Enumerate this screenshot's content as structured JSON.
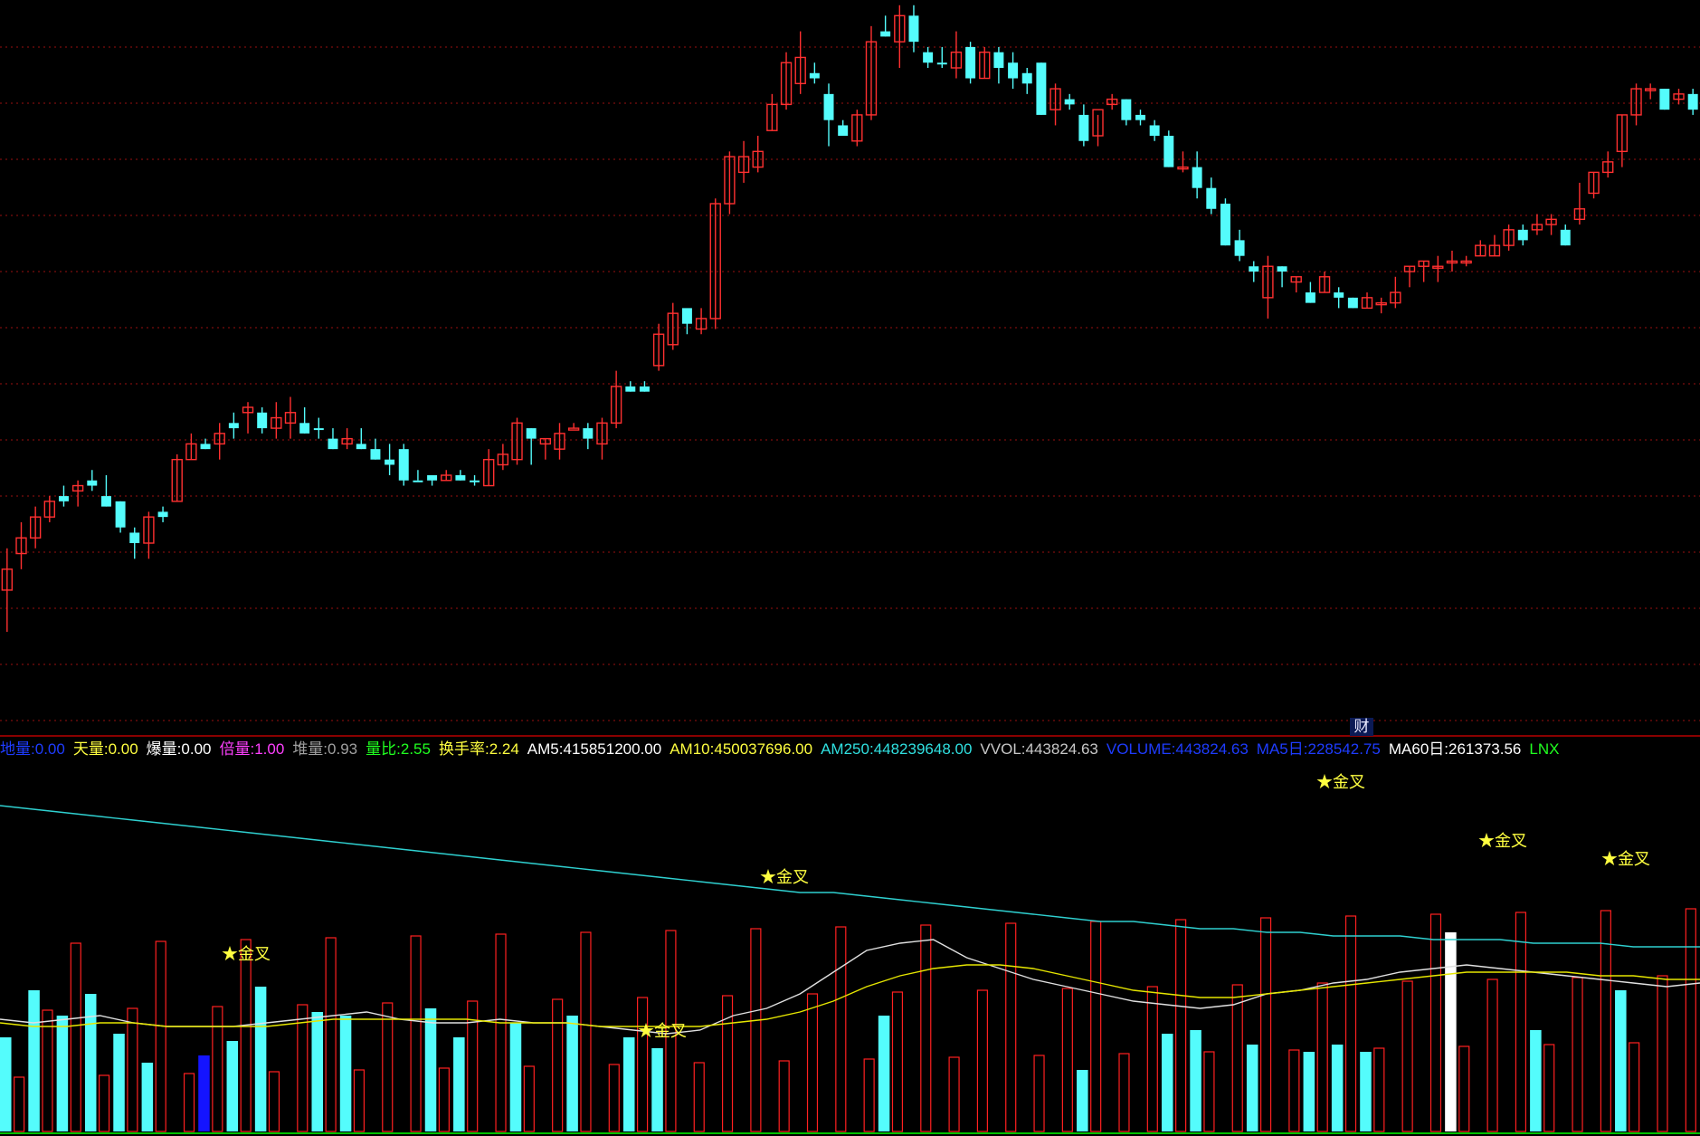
{
  "colors": {
    "up": "#ff3030",
    "down": "#54fcfc",
    "grid": "#9a1010",
    "vol_fill_up": "#54fcfc",
    "vol_outline": "#ff2020",
    "vol_magenta": "#ff20ff",
    "vol_blue": "#1414ff",
    "vol_white": "#ffffff",
    "ma5_line": "#e0e0e0",
    "ma10_line": "#e6e600",
    "ma250_line": "#2fd0d0",
    "label_gold": "#ffff40"
  },
  "fin_badge": "财",
  "indicator_bar": [
    {
      "label": "地量:",
      "value": "0.00",
      "color": "#1e3cff"
    },
    {
      "label": "天量:",
      "value": "0.00",
      "color": "#ffff40"
    },
    {
      "label": "爆量:",
      "value": "0.00",
      "color": "#ffffff"
    },
    {
      "label": "倍量:",
      "value": "1.00",
      "color": "#ff40ff"
    },
    {
      "label": "堆量:",
      "value": "0.93",
      "color": "#a0a0a0"
    },
    {
      "label": "量比:",
      "value": "2.55",
      "color": "#20ff20"
    },
    {
      "label": "换手率:",
      "value": "2.24",
      "color": "#ffff40"
    },
    {
      "label": "AM5:",
      "value": "415851200.00",
      "color": "#ffffff"
    },
    {
      "label": "AM10:",
      "value": "450037696.00",
      "color": "#ffff40"
    },
    {
      "label": "AM250:",
      "value": "448239648.00",
      "color": "#30e0e0"
    },
    {
      "label": "VVOL:",
      "value": "443824.63",
      "color": "#c8c8c8"
    },
    {
      "label": "VOLUME:",
      "value": "443824.63",
      "color": "#1e3cff"
    },
    {
      "label": "MA5日:",
      "value": "228542.75",
      "color": "#1e3cff"
    },
    {
      "label": "MA60日:",
      "value": "261373.56",
      "color": "#ffffff"
    },
    {
      "label": "LNX",
      "value": "",
      "color": "#20ff20"
    }
  ],
  "chart_data": [
    {
      "type": "candlestick",
      "price_range": [
        0,
        100
      ],
      "grid": true,
      "candles": [
        [
          17,
          21,
          9,
          25,
          1
        ],
        [
          24,
          27,
          21,
          30,
          1
        ],
        [
          27,
          31,
          25,
          33,
          1
        ],
        [
          31,
          34,
          30,
          35,
          1
        ],
        [
          34,
          35,
          33,
          37,
          0
        ],
        [
          36,
          37,
          33,
          38,
          1
        ],
        [
          37,
          38,
          36,
          40,
          0
        ],
        [
          35,
          33,
          33,
          39,
          0
        ],
        [
          34,
          29,
          28,
          34,
          0
        ],
        [
          28,
          26,
          23,
          29,
          0
        ],
        [
          26,
          31,
          23,
          32,
          1
        ],
        [
          31,
          32,
          30,
          33,
          0
        ],
        [
          34,
          42,
          34,
          43,
          1
        ],
        [
          42,
          45,
          42,
          47,
          1
        ],
        [
          44,
          45,
          44,
          46,
          0
        ],
        [
          45,
          47,
          42,
          49,
          1
        ],
        [
          48,
          49,
          46,
          51,
          0
        ],
        [
          52,
          51,
          47,
          53,
          1
        ],
        [
          51,
          48,
          47,
          52,
          0
        ],
        [
          48,
          50,
          46,
          53,
          1
        ],
        [
          51,
          49,
          46,
          54,
          1
        ],
        [
          49,
          47,
          47,
          52,
          0
        ],
        [
          48,
          48,
          46,
          50,
          0
        ],
        [
          46,
          44,
          44,
          48,
          0
        ],
        [
          45,
          46,
          44,
          48,
          1
        ],
        [
          45,
          44,
          44,
          48,
          0
        ],
        [
          44,
          42,
          42,
          46,
          0
        ],
        [
          42,
          41,
          39,
          45,
          0
        ],
        [
          44,
          38,
          37,
          45,
          0
        ],
        [
          38,
          38,
          38,
          40,
          0
        ],
        [
          39,
          38,
          37,
          39,
          0
        ],
        [
          38,
          39,
          38,
          40,
          1
        ],
        [
          39,
          38,
          38,
          40,
          0
        ],
        [
          38,
          38,
          37,
          39,
          0
        ],
        [
          37,
          42,
          37,
          44,
          1
        ],
        [
          41,
          43,
          40,
          45,
          1
        ],
        [
          42,
          49,
          41,
          50,
          1
        ],
        [
          48,
          46,
          41,
          48,
          0
        ],
        [
          45,
          46,
          42,
          46,
          1
        ],
        [
          44,
          47,
          42,
          49,
          1
        ],
        [
          48,
          48,
          48,
          49,
          1
        ],
        [
          48,
          46,
          44,
          49,
          0
        ],
        [
          45,
          49,
          42,
          50,
          1
        ],
        [
          49,
          56,
          48,
          59,
          1
        ],
        [
          55,
          56,
          55,
          57,
          0
        ],
        [
          56,
          55,
          55,
          57,
          0
        ],
        [
          60,
          66,
          59,
          68,
          1
        ],
        [
          64,
          70,
          63,
          72,
          1
        ],
        [
          71,
          68,
          66,
          70,
          0
        ],
        [
          67,
          69,
          66,
          71,
          1
        ],
        [
          69,
          91,
          67,
          92,
          1
        ],
        [
          91,
          100,
          89,
          101,
          1
        ],
        [
          100,
          97,
          95,
          103,
          1
        ],
        [
          98,
          101,
          97,
          104,
          1
        ],
        [
          105,
          110,
          105,
          112,
          1
        ],
        [
          110,
          118,
          109,
          120,
          1
        ],
        [
          119,
          114,
          112,
          124,
          1
        ],
        [
          116,
          115,
          114,
          118,
          0
        ],
        [
          112,
          107,
          102,
          114,
          0
        ],
        [
          106,
          104,
          104,
          107,
          0
        ],
        [
          103,
          108,
          102,
          109,
          1
        ],
        [
          108,
          122,
          107,
          125,
          1
        ],
        [
          124,
          123,
          123,
          127,
          0
        ],
        [
          122,
          127,
          117,
          129,
          1
        ],
        [
          127,
          122,
          120,
          129,
          0
        ],
        [
          120,
          118,
          117,
          121,
          0
        ],
        [
          118,
          118,
          117,
          121,
          0
        ],
        [
          117,
          120,
          115,
          124,
          1
        ],
        [
          121,
          115,
          114,
          122,
          0
        ],
        [
          120,
          115,
          115,
          121,
          1
        ],
        [
          120,
          117,
          114,
          121,
          0
        ],
        [
          118,
          115,
          113,
          120,
          0
        ],
        [
          116,
          114,
          112,
          117,
          0
        ],
        [
          118,
          108,
          108,
          118,
          0
        ],
        [
          109,
          113,
          106,
          114,
          1
        ],
        [
          111,
          110,
          109,
          112,
          0
        ],
        [
          108,
          103,
          102,
          110,
          0
        ],
        [
          104,
          109,
          102,
          108,
          1
        ],
        [
          111,
          110,
          109,
          112,
          1
        ],
        [
          111,
          107,
          106,
          111,
          0
        ],
        [
          108,
          107,
          106,
          109,
          0
        ],
        [
          106,
          104,
          103,
          107,
          0
        ],
        [
          104,
          98,
          98,
          105,
          0
        ],
        [
          98,
          98,
          97,
          101,
          1
        ],
        [
          98,
          94,
          92,
          101,
          0
        ],
        [
          94,
          90,
          89,
          96,
          0
        ],
        [
          91,
          83,
          83,
          92,
          0
        ],
        [
          84,
          81,
          80,
          86,
          0
        ],
        [
          79,
          78,
          76,
          80,
          0
        ],
        [
          79,
          73,
          69,
          81,
          1
        ],
        [
          79,
          78,
          75,
          79,
          0
        ],
        [
          76,
          77,
          74,
          77,
          1
        ],
        [
          74,
          72,
          72,
          76,
          0
        ],
        [
          77,
          74,
          74,
          78,
          1
        ],
        [
          74,
          73,
          71,
          75,
          0
        ],
        [
          73,
          71,
          71,
          73,
          0
        ],
        [
          73,
          71,
          71,
          74,
          1
        ],
        [
          72,
          72,
          70,
          73,
          1
        ],
        [
          72,
          74,
          71,
          77,
          1
        ],
        [
          78,
          79,
          75,
          79,
          1
        ],
        [
          79,
          80,
          76,
          80,
          1
        ],
        [
          79,
          79,
          76,
          81,
          1
        ],
        [
          80,
          80,
          78,
          82,
          1
        ],
        [
          80,
          80,
          79,
          81,
          1
        ],
        [
          81,
          83,
          81,
          84,
          1
        ],
        [
          81,
          83,
          81,
          85,
          1
        ],
        [
          83,
          86,
          82,
          87,
          1
        ],
        [
          86,
          84,
          83,
          87,
          0
        ],
        [
          86,
          87,
          85,
          89,
          1
        ],
        [
          87,
          88,
          85,
          89,
          1
        ],
        [
          86,
          83,
          83,
          87,
          0
        ],
        [
          88,
          90,
          87,
          95,
          1
        ],
        [
          93,
          97,
          92,
          97,
          1
        ],
        [
          97,
          99,
          96,
          101,
          1
        ],
        [
          101,
          108,
          98,
          108,
          1
        ],
        [
          108,
          113,
          106,
          114,
          1
        ],
        [
          113,
          113,
          111,
          114,
          1
        ],
        [
          113,
          109,
          109,
          113,
          0
        ],
        [
          111,
          112,
          110,
          113,
          1
        ],
        [
          112,
          109,
          108,
          113,
          0
        ]
      ]
    },
    {
      "type": "bar",
      "series": [
        {
          "name": "VOLUME",
          "values": [
            26,
            0,
            39,
            0,
            32,
            0,
            38,
            0,
            27,
            0,
            19,
            0,
            0,
            0,
            21,
            0,
            25,
            0,
            40,
            0,
            0,
            0,
            33,
            0,
            32,
            0,
            0,
            0,
            0,
            0,
            34,
            0,
            26,
            0,
            0,
            0,
            30,
            0,
            0,
            0,
            32,
            0,
            0,
            0,
            26,
            0,
            23,
            0,
            0,
            0,
            0,
            0,
            0,
            0,
            0,
            0,
            0,
            0,
            0,
            0,
            0,
            0,
            32,
            0,
            0,
            0,
            0,
            0,
            0,
            0,
            0,
            0,
            0,
            0,
            0,
            0,
            17,
            0,
            0,
            0,
            0,
            0,
            27,
            0,
            28,
            0,
            0,
            0,
            24,
            0,
            0,
            0,
            22,
            0,
            24,
            0,
            22,
            0,
            0,
            0,
            0,
            0,
            55,
            0,
            0,
            0,
            0,
            0,
            28,
            0,
            0,
            0,
            0,
            0,
            39,
            0,
            0,
            0,
            0,
            0
          ]
        },
        {
          "name": "MA5",
          "values": [
            31,
            30,
            31,
            32,
            30,
            29,
            29,
            29,
            30,
            31,
            32,
            33,
            31,
            30,
            30,
            31,
            30,
            30,
            29,
            28,
            27,
            28,
            32,
            34,
            38,
            44,
            50,
            52,
            53,
            48,
            45,
            42,
            40,
            38,
            36,
            35,
            34,
            35,
            38,
            39,
            41,
            42,
            44,
            45,
            46,
            45,
            44,
            43,
            42,
            41,
            40,
            41
          ]
        },
        {
          "name": "MA10",
          "values": [
            30,
            29,
            29,
            30,
            30,
            29,
            29,
            29,
            29,
            30,
            31,
            31,
            31,
            31,
            31,
            30,
            30,
            30,
            29,
            29,
            29,
            29,
            30,
            31,
            33,
            36,
            40,
            43,
            45,
            46,
            46,
            45,
            43,
            41,
            39,
            38,
            37,
            37,
            38,
            39,
            40,
            41,
            42,
            43,
            44,
            44,
            44,
            44,
            43,
            43,
            42,
            42
          ]
        },
        {
          "name": "MA250",
          "values": [
            90,
            89,
            88,
            87,
            86,
            85,
            84,
            83,
            82,
            81,
            80,
            79,
            78,
            77,
            76,
            75,
            74,
            73,
            72,
            71,
            70,
            69,
            68,
            67,
            66,
            66,
            65,
            64,
            63,
            62,
            61,
            60,
            59,
            58,
            58,
            57,
            56,
            56,
            55,
            55,
            54,
            54,
            54,
            53,
            53,
            53,
            52,
            52,
            52,
            51,
            51,
            51
          ]
        }
      ],
      "annotations": [
        "★金叉",
        "★金叉",
        "★金叉",
        "★金叉",
        "★金叉",
        "★金叉"
      ],
      "annotation_label": "金叉"
    }
  ]
}
